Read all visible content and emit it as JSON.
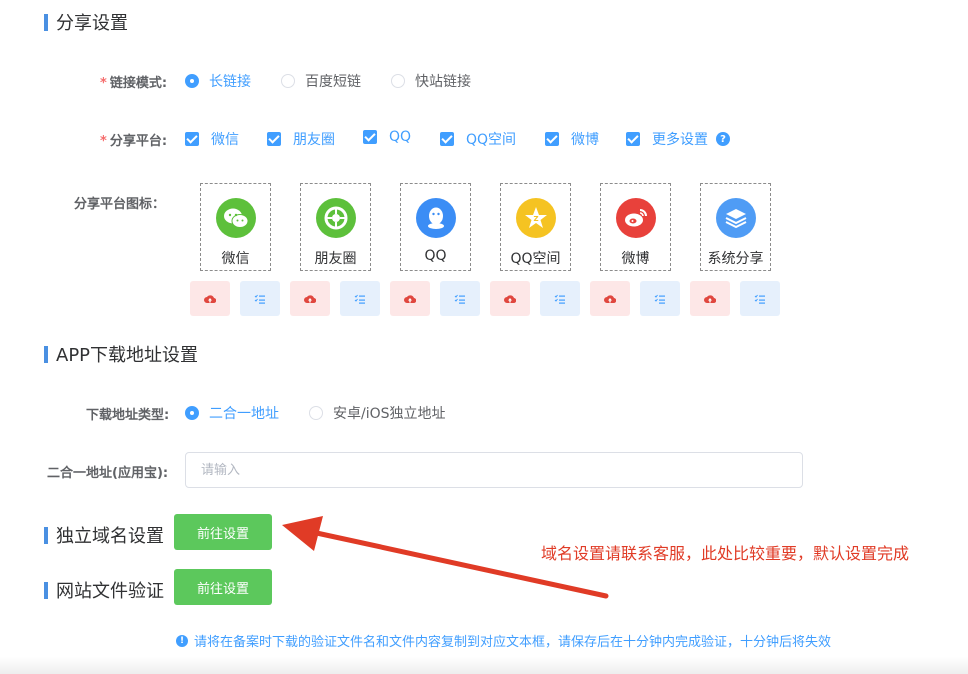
{
  "share": {
    "title": "分享设置",
    "link_mode_label": "链接模式:",
    "link_modes": [
      "长链接",
      "百度短链",
      "快站链接"
    ],
    "platform_label": "分享平台:",
    "platforms": [
      "微信",
      "朋友圈",
      "QQ",
      "QQ空间",
      "微博",
      "更多设置"
    ],
    "icon_label": "分享平台图标：",
    "icons": [
      "微信",
      "朋友圈",
      "QQ",
      "QQ空间",
      "微博",
      "系统分享"
    ]
  },
  "app": {
    "title": "APP下载地址设置",
    "type_label": "下载地址类型:",
    "types": [
      "二合一地址",
      "安卓/iOS独立地址"
    ],
    "addr_label": "二合一地址(应用宝):",
    "addr_placeholder": "请输入"
  },
  "domain": {
    "title": "独立域名设置",
    "button": "前往设置"
  },
  "verify": {
    "title": "网站文件验证",
    "button": "前往设置"
  },
  "annotation": "域名设置请联系客服，此处比较重要，默认设置完成",
  "tip": "请将在备案时下载的验证文件名和文件内容复制到对应文本框，请保存后在十分钟内完成验证，十分钟后将失效",
  "colors": {
    "accent": "#409eff",
    "green": "#5cc85c",
    "annotation": "#e03b26"
  }
}
